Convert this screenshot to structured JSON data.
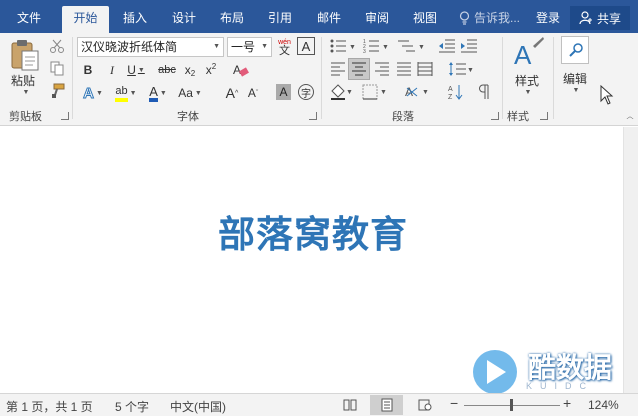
{
  "tabs": [
    "文件",
    "开始",
    "插入",
    "设计",
    "布局",
    "引用",
    "邮件",
    "审阅",
    "视图"
  ],
  "active_tab": "开始",
  "tell_me": "告诉我...",
  "login": "登录",
  "share": "共享",
  "clipboard": {
    "paste": "粘贴",
    "label": "剪贴板"
  },
  "font": {
    "name": "汉仪晓波折纸体简",
    "size": "一号",
    "label": "字体",
    "phonetic": "wén",
    "phonetic_char": "文"
  },
  "paragraph": {
    "label": "段落"
  },
  "styles": {
    "button": "样式",
    "label": "样式"
  },
  "editing": {
    "button": "编辑"
  },
  "document": {
    "text": "部落窝教育"
  },
  "watermark": {
    "title": "酷数据",
    "sub": "KUIDC"
  },
  "status": {
    "page": "第 1 页，共 1 页",
    "words": "5 个字",
    "language": "中文(中国)",
    "zoom": "124%"
  },
  "colors": {
    "brand": "#2b579a",
    "doc_text": "#2e75b6",
    "highlight": "#ffff00",
    "font_color": "#1f5bb5"
  }
}
